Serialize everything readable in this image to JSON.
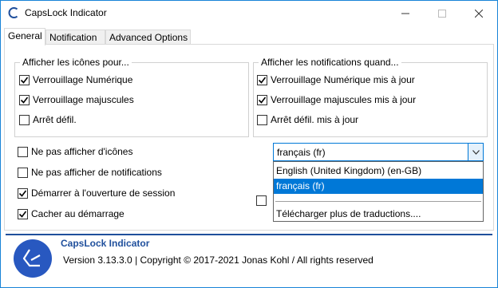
{
  "window": {
    "title": "CapsLock Indicator",
    "controls": {
      "minimize": "–",
      "maximize": "□",
      "close": "✕"
    }
  },
  "tabs": [
    {
      "label": "General",
      "active": true
    },
    {
      "label": "Notification",
      "active": false
    },
    {
      "label": "Advanced Options",
      "active": false
    }
  ],
  "icons_group": {
    "title": "Afficher les icônes pour...",
    "options": [
      {
        "label": "Verrouillage Numérique",
        "checked": true
      },
      {
        "label": "Verrouillage majuscules",
        "checked": true
      },
      {
        "label": "Arrêt défil.",
        "checked": false
      }
    ]
  },
  "notif_group": {
    "title": "Afficher les notifications quand...",
    "options": [
      {
        "label": "Verrouillage Numérique mis à jour",
        "checked": true
      },
      {
        "label": "Verrouillage majuscules mis à jour",
        "checked": true
      },
      {
        "label": "Arrêt défil. mis à jour",
        "checked": false
      }
    ]
  },
  "general_options": [
    {
      "label": "Ne pas afficher d'icônes",
      "checked": false
    },
    {
      "label": "Ne pas afficher de notifications",
      "checked": false
    },
    {
      "label": "Démarrer à l'ouverture de session",
      "checked": true
    },
    {
      "label": "Cacher au démarrage",
      "checked": true
    }
  ],
  "language": {
    "selected": "français (fr)",
    "options": [
      {
        "label": "English (United Kingdom) (en-GB)",
        "selected": false
      },
      {
        "label": "français (fr)",
        "selected": true
      }
    ],
    "more_link": "Télécharger plus de traductions...."
  },
  "footer": {
    "app_name": "CapsLock Indicator",
    "version_text": "Version 3.13.3.0 | Copyright © 2017-2021 Jonas Kohl / All rights reserved"
  },
  "colors": {
    "accent": "#0078d7",
    "brand": "#1f4f9c",
    "border": "#1883d7"
  }
}
